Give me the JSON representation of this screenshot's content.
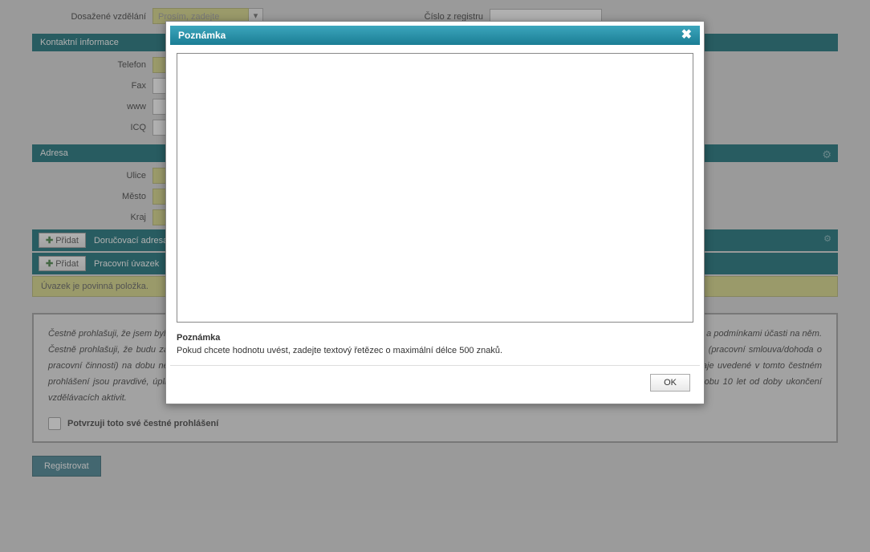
{
  "form": {
    "education_label": "Dosažené vzdělání",
    "education_placeholder": "Prosím, zadejte",
    "registry_label": "Číslo z registru"
  },
  "sections": {
    "contact_title": "Kontaktní informace",
    "address_title": "Adresa",
    "phone": "Telefon",
    "fax": "Fax",
    "www": "www",
    "icq": "ICQ",
    "street": "Ulice",
    "city": "Město",
    "region": "Kraj"
  },
  "buttons": {
    "add": "Přidat",
    "delivery_address": "Doručovací adresa",
    "work_contract": "Pracovní úvazek",
    "register": "Registrovat"
  },
  "warnings": {
    "contract_required": "Úvazek je povinná položka."
  },
  "declaration": {
    "text": "Čestně prohlašuji, že jsem byl/a seznámen/a s Projektem Vzdělávání zdravotníků (prohlubování a zvyšování vzdělávání), který je obsahem tohoto čestného prohlášení, a podmínkami účasti na něm. Čestně prohlašuji, že budu zaměstnancem, a to alespoň v rámci polovičního pracovního úvazku, minimálně po dobu trvání vzdělávacích aktivit a smluvního vztahu (pracovní smlouva/dohoda o pracovní činnosti) na dobu neurčitou v mimopražském zařízení, a tedy cílovou skupinou oprávněnou k účasti na tomto Projektu. Čestně prohlašuji, že všechny údaje uvedené v tomto čestném prohlášení jsou pravdivé, úplné a zakládají se na pravdě. Souhlasím se zpracováním mých osobních údajů po celou dobu trvání vzdělávacích aktivit a dále na dobu 10 let od doby ukončení vzdělávacích aktivit.",
    "checkbox_label": "Potvrzuji toto své čestné prohlášení"
  },
  "modal": {
    "title": "Poznámka",
    "textarea_value": "",
    "hint_title": "Poznámka",
    "hint_desc": "Pokud chcete hodnotu uvést, zadejte textový řetězec o maximální délce 500 znaků.",
    "ok": "OK"
  }
}
